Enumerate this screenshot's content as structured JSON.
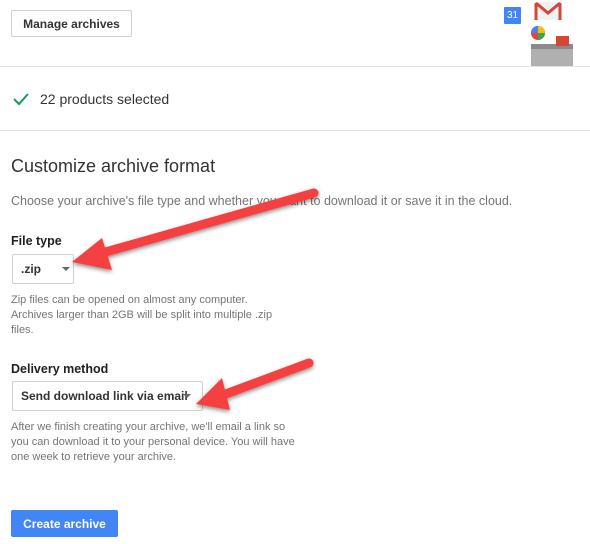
{
  "header": {
    "manage_label": "Manage archives",
    "calendar_day": "31"
  },
  "selection": {
    "text": "22 products selected"
  },
  "section": {
    "title": "Customize archive format",
    "description": "Choose your archive's file type and whether you want to download it or save it in the cloud."
  },
  "file_type": {
    "label": "File type",
    "value": ".zip",
    "help": "Zip files can be opened on almost any computer. Archives larger than 2GB will be split into multiple .zip files."
  },
  "delivery": {
    "label": "Delivery method",
    "value": "Send download link via email",
    "help": "After we finish creating your archive, we'll email a link so you can download it to your personal device. You will have one week to retrieve your archive."
  },
  "create_label": "Create archive",
  "colors": {
    "accent": "#4285f4",
    "check": "#0f9d58",
    "arrow": "#f44040"
  }
}
